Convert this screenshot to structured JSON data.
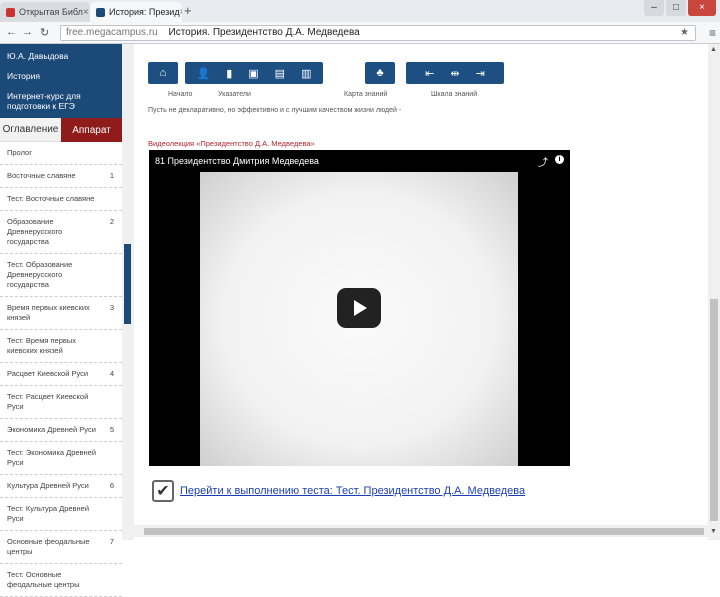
{
  "browser": {
    "tabs": [
      {
        "title": "Открытая Библ",
        "active": false
      },
      {
        "title": "История: Презид",
        "active": true
      }
    ],
    "address": {
      "url": "free.megacampus.ru",
      "page_title": "История. Президентство Д.А. Медведева"
    }
  },
  "sidebar": {
    "header": [
      "Ю.А. Давыдова",
      "История",
      "Интернет-курс для подготовки к ЕГЭ"
    ],
    "tabs": [
      "Оглавление",
      "Аппарат"
    ],
    "items": [
      {
        "label": "Пролог",
        "num": ""
      },
      {
        "label": "Восточные славяне",
        "num": "1"
      },
      {
        "label": "Тест. Восточные славяне",
        "num": ""
      },
      {
        "label": "Образование Древнерусского государства",
        "num": "2"
      },
      {
        "label": "Тест. Образование Древнерусского государства",
        "num": ""
      },
      {
        "label": "Время первых киевских князей",
        "num": "3"
      },
      {
        "label": "Тест. Время первых киевских князей",
        "num": ""
      },
      {
        "label": "Расцвет Киевской Руси",
        "num": "4"
      },
      {
        "label": "Тест. Расцвет Киевской Руси",
        "num": ""
      },
      {
        "label": "Экономика Древней Руси",
        "num": "5"
      },
      {
        "label": "Тест. Экономика Древней Руси",
        "num": ""
      },
      {
        "label": "Культура Древней Руси",
        "num": "6"
      },
      {
        "label": "Тест. Культура Древней Руси",
        "num": ""
      },
      {
        "label": "Основные феодальные центры",
        "num": "7"
      },
      {
        "label": "Тест. Основные феодальные центры",
        "num": ""
      }
    ]
  },
  "toolbar": {
    "labels": [
      "Начало",
      "Указатели",
      "Карта знаний",
      "Шкала знаний"
    ]
  },
  "main": {
    "intro": "Пусть не декларативно, но эффективно и с лучшим качеством жизни людей -",
    "video_caption": "Видеолекция «Президентство Д.А. Медведева»",
    "video_title": "81 Президентство Дмитрия Медведева",
    "test_link": "Перейти к выполнению теста: Тест. Президентство Д.А. Медведева"
  }
}
